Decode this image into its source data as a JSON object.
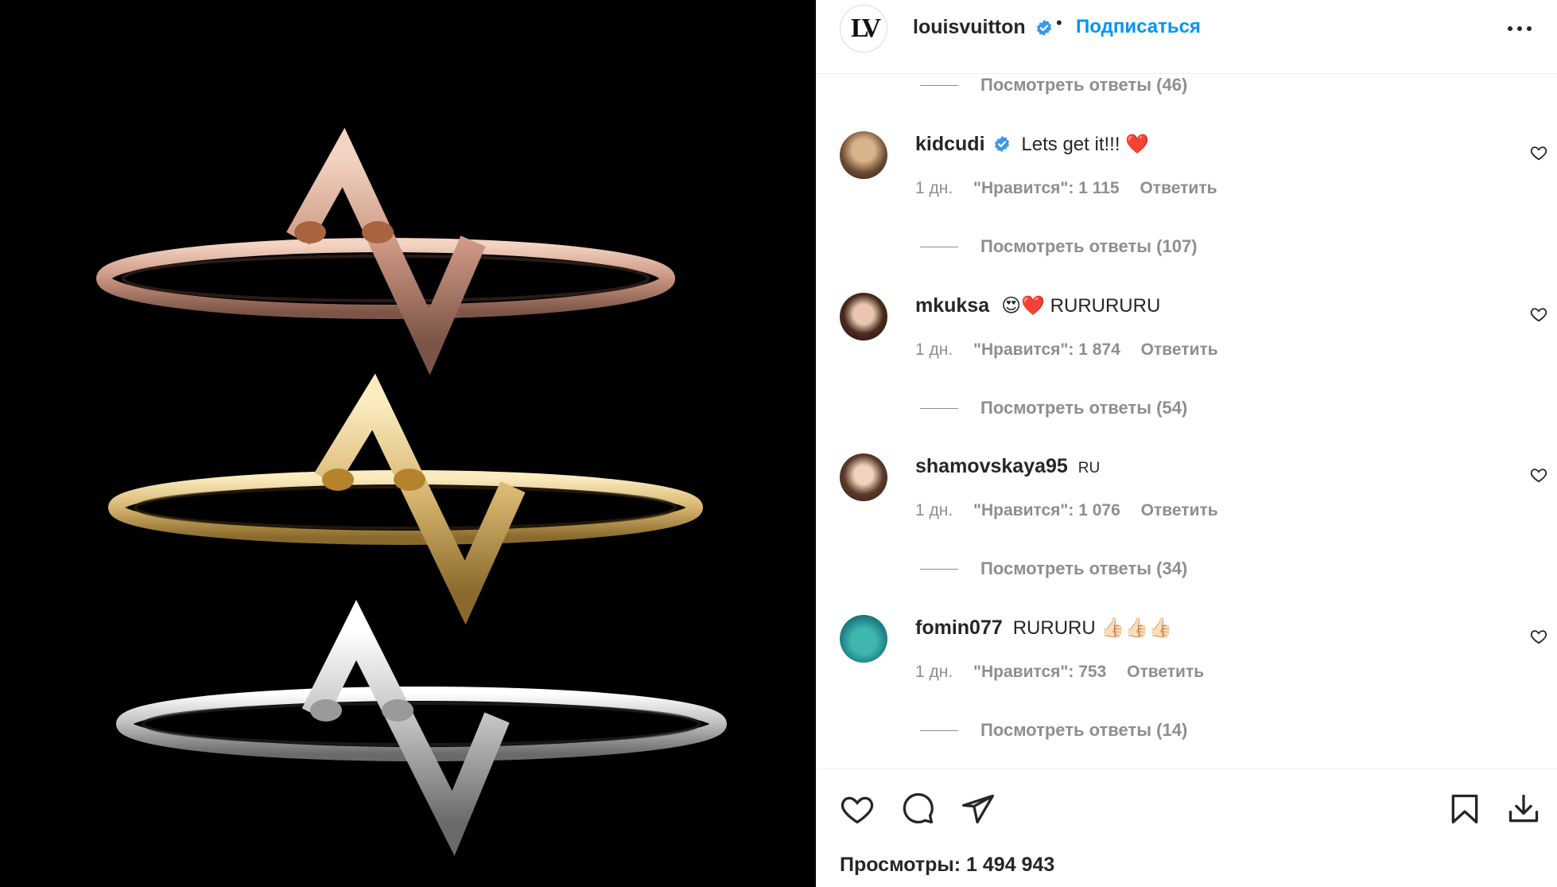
{
  "header": {
    "username": "louisvuitton",
    "dot": "•",
    "follow_label": "Подписаться",
    "avatar_monogram": "LV"
  },
  "top_replies": "Посмотреть ответы (46)",
  "comments": [
    {
      "username": "kidcudi",
      "verified": true,
      "text": "Lets get it!!! ❤️",
      "time": "1 дн.",
      "likes": "\"Нравится\": 1 115",
      "reply": "Ответить",
      "view_replies": "Посмотреть ответы (107)"
    },
    {
      "username": "mkuksa",
      "verified": false,
      "text": "😍❤️ RURURURU",
      "time": "1 дн.",
      "likes": "\"Нравится\": 1 874",
      "reply": "Ответить",
      "view_replies": "Посмотреть ответы (54)"
    },
    {
      "username": "shamovskaya95",
      "verified": false,
      "text": "RU",
      "time": "1 дн.",
      "likes": "\"Нравится\": 1 076",
      "reply": "Ответить",
      "view_replies": "Посмотреть ответы (34)"
    },
    {
      "username": "fomin077",
      "verified": false,
      "text": "RURURU 👍🏻👍🏻👍🏻",
      "time": "1 дн.",
      "likes": "\"Нравится\": 753",
      "reply": "Ответить",
      "view_replies": "Посмотреть ответы (14)"
    }
  ],
  "views": "Просмотры: 1 494 943",
  "colors": {
    "accent": "#0095f6",
    "verified": "#3897f0",
    "muted": "#8e8e8e",
    "text": "#262626"
  },
  "icons": [
    "heart-icon",
    "comment-icon",
    "share-icon",
    "bookmark-icon",
    "download-icon",
    "more-icon"
  ]
}
